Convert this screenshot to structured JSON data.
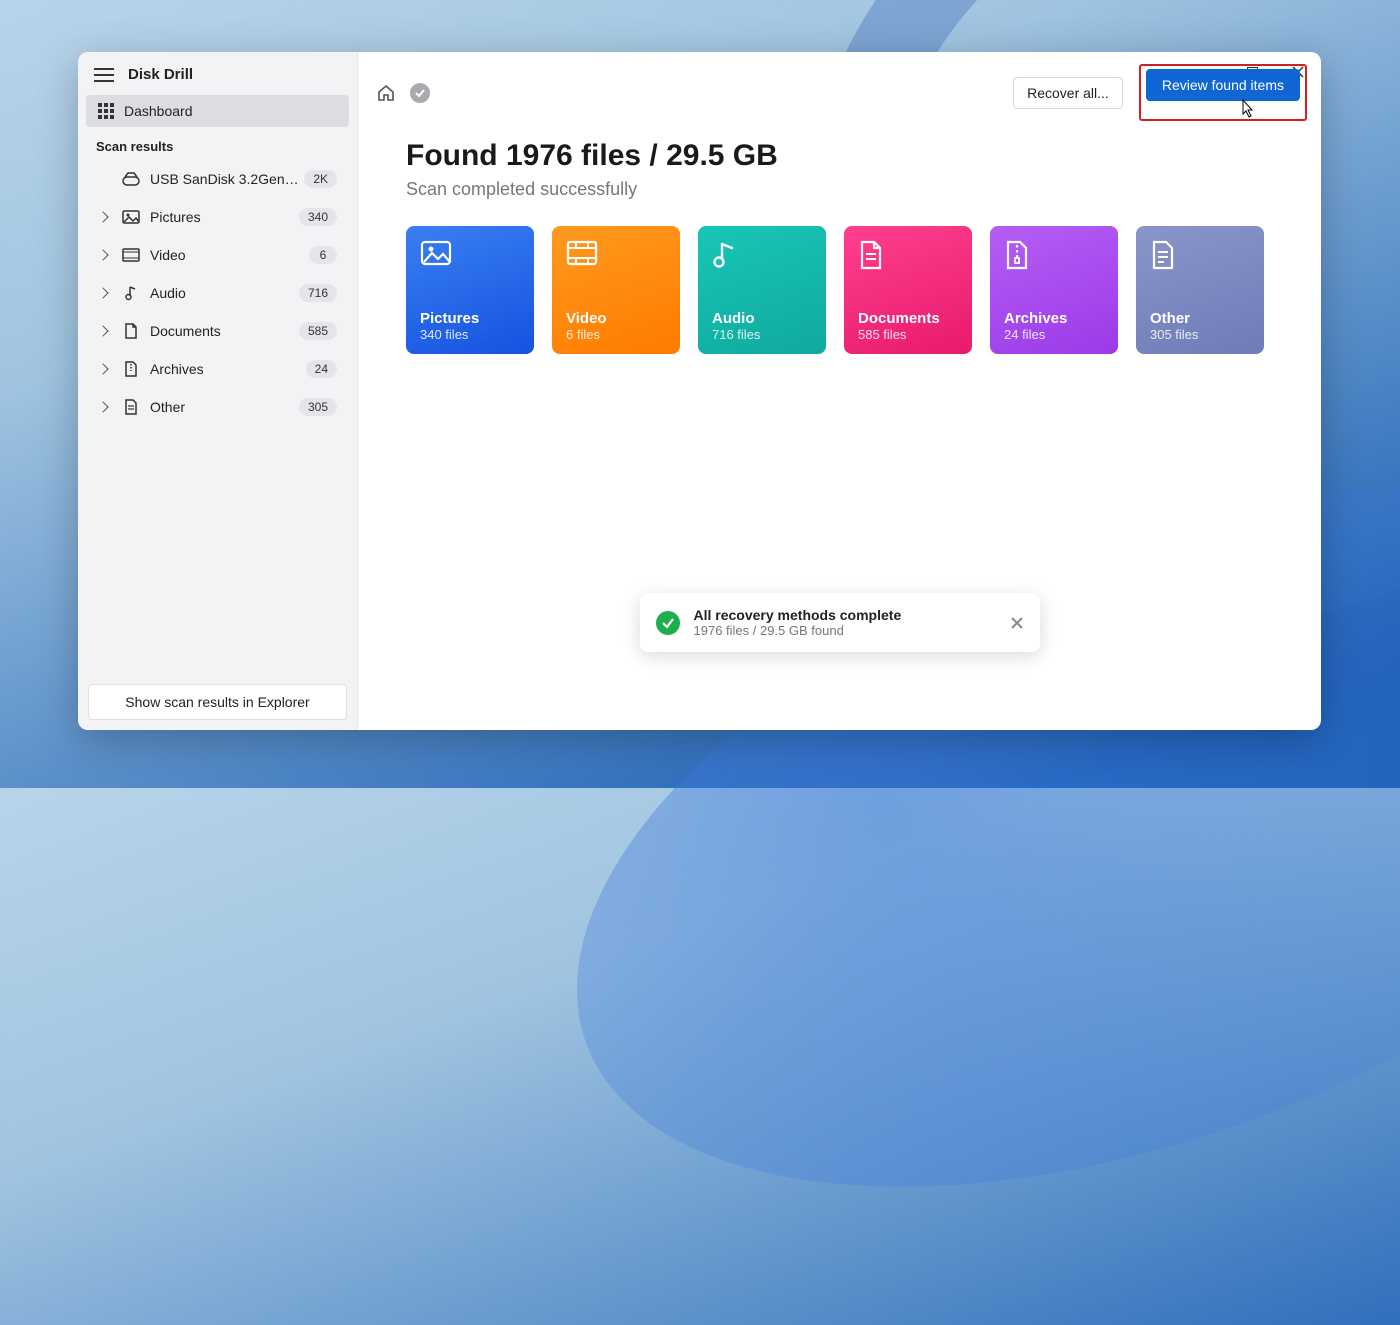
{
  "app": {
    "title": "Disk Drill"
  },
  "sidebar": {
    "dashboard_label": "Dashboard",
    "section_label": "Scan results",
    "device": {
      "label": "USB  SanDisk 3.2Gen1 US...",
      "badge": "2K"
    },
    "cats": [
      {
        "label": "Pictures",
        "badge": "340"
      },
      {
        "label": "Video",
        "badge": "6"
      },
      {
        "label": "Audio",
        "badge": "716"
      },
      {
        "label": "Documents",
        "badge": "585"
      },
      {
        "label": "Archives",
        "badge": "24"
      },
      {
        "label": "Other",
        "badge": "305"
      }
    ],
    "footer_button": "Show scan results in Explorer"
  },
  "topbar": {
    "recover_label": "Recover all...",
    "review_label": "Review found items"
  },
  "summary": {
    "headline": "Found 1976 files / 29.5 GB",
    "subhead": "Scan completed successfully"
  },
  "tiles": [
    {
      "name": "Pictures",
      "count": "340 files"
    },
    {
      "name": "Video",
      "count": "6 files"
    },
    {
      "name": "Audio",
      "count": "716 files"
    },
    {
      "name": "Documents",
      "count": "585 files"
    },
    {
      "name": "Archives",
      "count": "24 files"
    },
    {
      "name": "Other",
      "count": "305 files"
    }
  ],
  "toast": {
    "title": "All recovery methods complete",
    "detail": "1976 files / 29.5 GB found"
  }
}
